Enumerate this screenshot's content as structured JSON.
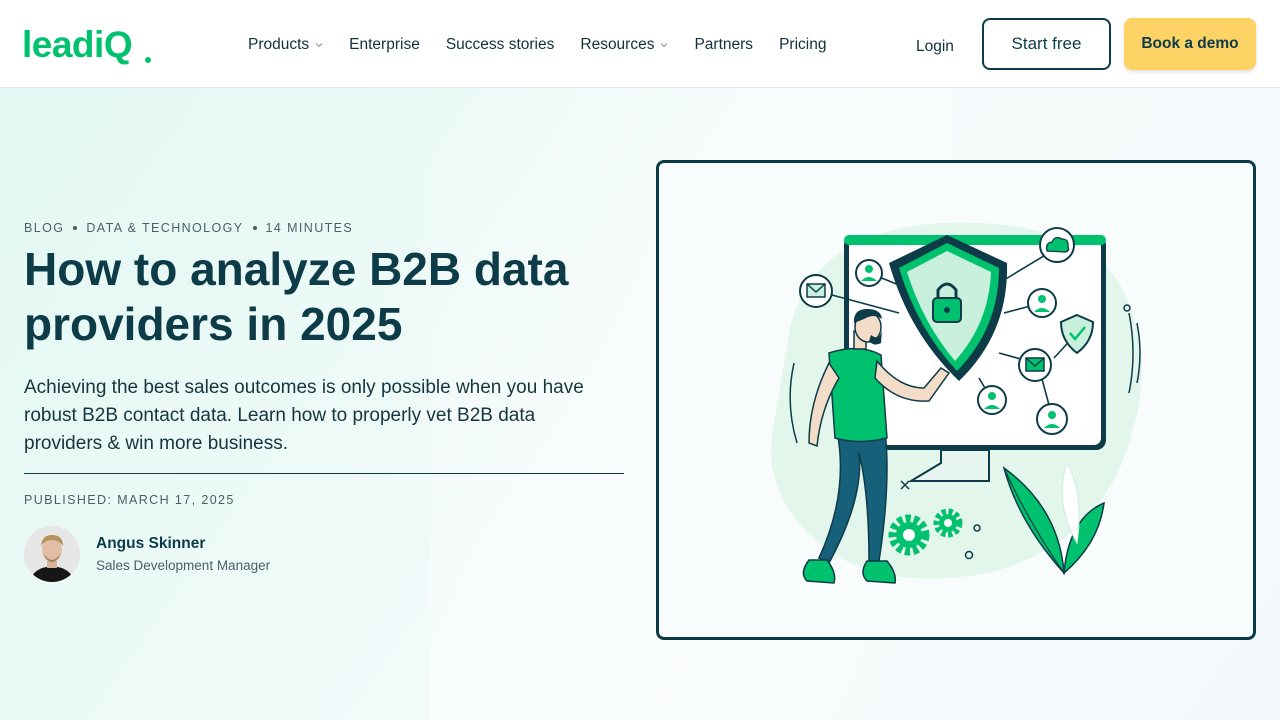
{
  "brand": {
    "logo_text": "leadiQ",
    "accent": "#00c26e",
    "navy": "#0d3b48",
    "yellow": "#fdd365"
  },
  "nav": {
    "items": [
      {
        "label": "Products",
        "has_dropdown": true
      },
      {
        "label": "Enterprise",
        "has_dropdown": false
      },
      {
        "label": "Success stories",
        "has_dropdown": false
      },
      {
        "label": "Resources",
        "has_dropdown": true
      },
      {
        "label": "Partners",
        "has_dropdown": false
      },
      {
        "label": "Pricing",
        "has_dropdown": false
      }
    ],
    "login": "Login",
    "start_free": "Start free",
    "book_demo": "Book a demo"
  },
  "article": {
    "meta": {
      "category": "BLOG",
      "topic": "DATA & TECHNOLOGY",
      "read_time": "14 MINUTES"
    },
    "title": "How to analyze B2B data providers in 2025",
    "description": "Achieving the best sales outcomes is only possible when you have robust B2B contact data. Learn how to properly vet B2B data providers & win more business.",
    "published": "PUBLISHED: MARCH 17, 2025",
    "author": {
      "name": "Angus Skinner",
      "role": "Sales Development Manager"
    }
  },
  "illustration": {
    "icons": [
      "shield-lock-icon",
      "mail-icon",
      "user-icon",
      "cloud-icon",
      "check-shield-icon",
      "gear-icon",
      "leaf-icon"
    ]
  }
}
